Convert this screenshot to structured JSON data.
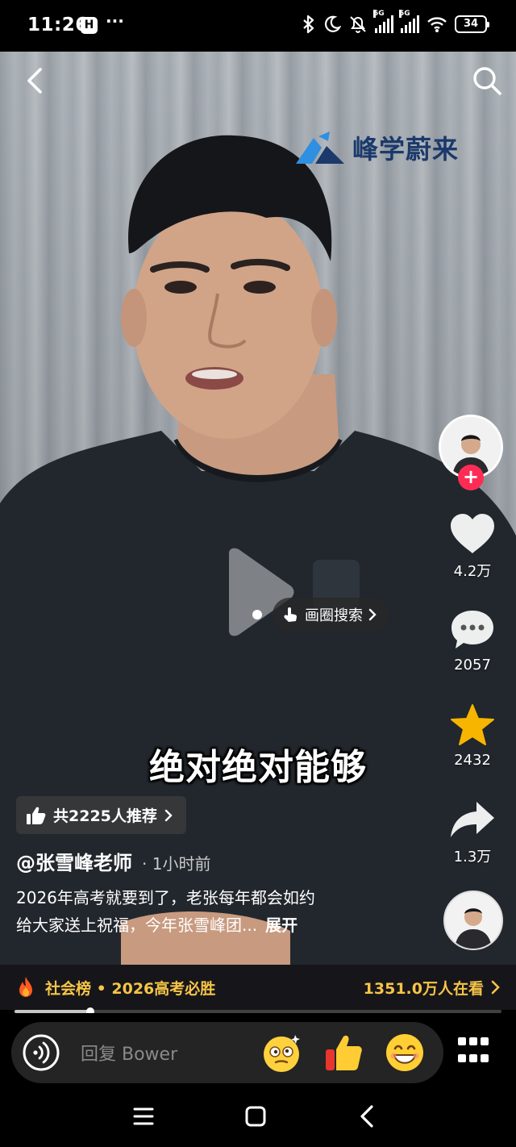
{
  "status_bar": {
    "time": "11:26",
    "app_icon_glyph": "H",
    "more": "···",
    "icons": [
      "bluetooth-icon",
      "moon-icon",
      "bell-mute-icon"
    ],
    "network_1": "5G",
    "network_2": "5G",
    "battery": "34"
  },
  "video": {
    "brand_name": "峰学蔚来",
    "subtitle": "绝对绝对能够",
    "circle_search_label": "画圈搜索"
  },
  "rail": {
    "follow_symbol": "+",
    "likes": "4.2万",
    "comments": "2057",
    "favorites": "2432",
    "shares": "1.3万"
  },
  "info": {
    "recommend": "共2225人推荐",
    "author": "@张雪峰老师",
    "time": "· 1小时前",
    "desc_line1": "2026年高考就要到了，老张每年都会如约",
    "desc_line2": "给大家送上祝福，今年张雪峰团...",
    "expand": "展开"
  },
  "hot": {
    "label": "社会榜 • 2026高考必胜",
    "count": "1351.0万人在看"
  },
  "progress": {
    "fraction": 0.155
  },
  "comment": {
    "placeholder": "回复 Bower"
  },
  "colors": {
    "like": "#fe2c55",
    "favorite": "#f7b500",
    "hot_text": "#f6c447",
    "brand": "#1b3a6b",
    "brand_mark": "#2f8fe0"
  }
}
